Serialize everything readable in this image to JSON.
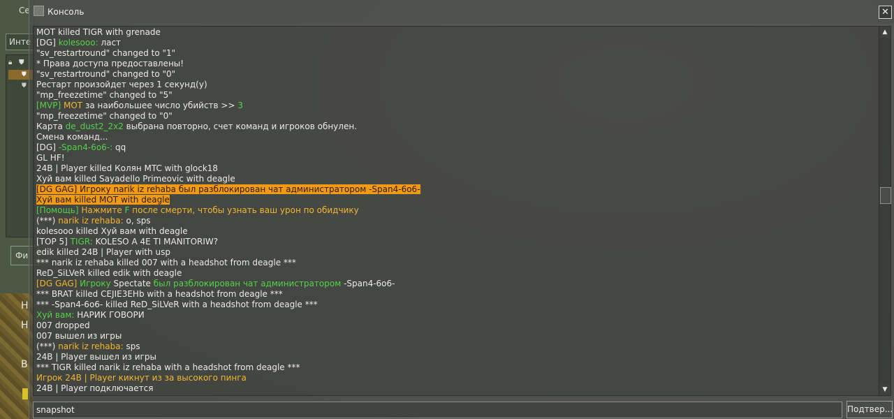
{
  "back_window": {
    "title": "Се",
    "tab_label": "Инте",
    "button_label": "Фи",
    "hud_letters": [
      "Н",
      "Н",
      "В"
    ]
  },
  "console": {
    "title": "Консоль",
    "close_label": "✕",
    "input_value": "snapshot",
    "submit_label": "Подтвер..."
  },
  "colors": {
    "green": "#52d24a",
    "orange": "#f2b630",
    "highlight": "#f29a12"
  },
  "log": [
    {
      "parts": [
        {
          "t": "MOT killed TIGR with grenade",
          "c": "white"
        }
      ]
    },
    {
      "parts": [
        {
          "t": "[DG] ",
          "c": "white"
        },
        {
          "t": "kolesooo:",
          "c": "green"
        },
        {
          "t": " ласт",
          "c": "white"
        }
      ]
    },
    {
      "parts": [
        {
          "t": "\"sv_restartround\" changed to \"1\"",
          "c": "white"
        }
      ]
    },
    {
      "parts": [
        {
          "t": "* Права доступа предоставлены!",
          "c": "white"
        }
      ]
    },
    {
      "parts": [
        {
          "t": "\"sv_restartround\" changed to \"0\"",
          "c": "white"
        }
      ]
    },
    {
      "parts": [
        {
          "t": "Рестарт произойдет через 1 секунд(у)",
          "c": "white"
        }
      ]
    },
    {
      "parts": [
        {
          "t": "\"mp_freezetime\" changed to \"5\"",
          "c": "white"
        }
      ]
    },
    {
      "parts": [
        {
          "t": "[MVP] ",
          "c": "green"
        },
        {
          "t": "MOT",
          "c": "orange"
        },
        {
          "t": " за наибольшее число убийств >> ",
          "c": "white"
        },
        {
          "t": "3",
          "c": "green"
        }
      ]
    },
    {
      "parts": [
        {
          "t": "\"mp_freezetime\" changed to \"0\"",
          "c": "white"
        }
      ]
    },
    {
      "parts": [
        {
          "t": "Карта ",
          "c": "white"
        },
        {
          "t": "de_dust2_2x2",
          "c": "green"
        },
        {
          "t": " выбрана повторно, счет команд и игроков обнулен.",
          "c": "white"
        }
      ]
    },
    {
      "parts": [
        {
          "t": "Смена команд...",
          "c": "white"
        }
      ]
    },
    {
      "parts": [
        {
          "t": "[DG] ",
          "c": "white"
        },
        {
          "t": "-Span4-6o6-:",
          "c": "green"
        },
        {
          "t": " qq",
          "c": "white"
        }
      ]
    },
    {
      "parts": [
        {
          "t": "GL HF!",
          "c": "white"
        }
      ]
    },
    {
      "parts": [
        {
          "t": "24B | Player killed Колян MTC with glock18",
          "c": "white"
        }
      ]
    },
    {
      "parts": [
        {
          "t": "Хуй вам killed Sayadello Primeovic with deagle",
          "c": "white"
        }
      ]
    },
    {
      "hl": true,
      "parts": [
        {
          "t": "[DG GAG] Игроку narik iz rehaba был разблокирован чат администратором -Span4-6o6-",
          "c": "white"
        }
      ]
    },
    {
      "hl": true,
      "parts": [
        {
          "t": "Хуй вам killed MOT with deagle",
          "c": "white"
        }
      ]
    },
    {
      "parts": [
        {
          "t": "[Помощь] ",
          "c": "green"
        },
        {
          "t": "Нажмите ",
          "c": "orange"
        },
        {
          "t": "F",
          "c": "green"
        },
        {
          "t": " после смерти, чтобы узнать ваш урон по обидчику",
          "c": "orange"
        }
      ]
    },
    {
      "parts": [
        {
          "t": "(***) ",
          "c": "white"
        },
        {
          "t": "narik iz rehaba:",
          "c": "orange"
        },
        {
          "t": " o, sps",
          "c": "white"
        }
      ]
    },
    {
      "parts": [
        {
          "t": "kolesooo killed Хуй вам with deagle",
          "c": "white"
        }
      ]
    },
    {
      "parts": [
        {
          "t": "[TOP 5] ",
          "c": "white"
        },
        {
          "t": "TIGR:",
          "c": "green"
        },
        {
          "t": " KOLESO A 4E TI MANITORIW?",
          "c": "white"
        }
      ]
    },
    {
      "parts": [
        {
          "t": "edik killed 24B | Player with usp",
          "c": "white"
        }
      ]
    },
    {
      "parts": [
        {
          "t": "*** narik iz rehaba killed 007 with a headshot from deagle ***",
          "c": "white"
        }
      ]
    },
    {
      "parts": [
        {
          "t": "ReD_SiLVeR killed edik with deagle",
          "c": "white"
        }
      ]
    },
    {
      "parts": [
        {
          "t": "[DG GAG] ",
          "c": "orange"
        },
        {
          "t": "Игроку ",
          "c": "green"
        },
        {
          "t": "Spectate",
          "c": "white"
        },
        {
          "t": " был разблокирован чат администратором ",
          "c": "green"
        },
        {
          "t": "-Span4-6o6-",
          "c": "white"
        }
      ]
    },
    {
      "parts": [
        {
          "t": "*** BRAT killed CEJIE3EHb with a headshot from deagle ***",
          "c": "white"
        }
      ]
    },
    {
      "parts": [
        {
          "t": "*** -Span4-6o6- killed ReD_SiLVeR with a headshot from deagle ***",
          "c": "white"
        }
      ]
    },
    {
      "parts": [
        {
          "t": "Хуй вам:",
          "c": "green"
        },
        {
          "t": " НАРИК ГОВОРИ",
          "c": "white"
        }
      ]
    },
    {
      "parts": [
        {
          "t": "007 dropped",
          "c": "white"
        }
      ]
    },
    {
      "parts": [
        {
          "t": "007 вышел из игры",
          "c": "white"
        }
      ]
    },
    {
      "parts": [
        {
          "t": "(***) ",
          "c": "white"
        },
        {
          "t": "narik iz rehaba:",
          "c": "orange"
        },
        {
          "t": " sps",
          "c": "white"
        }
      ]
    },
    {
      "parts": [
        {
          "t": "24B | Player вышел из игры",
          "c": "white"
        }
      ]
    },
    {
      "parts": [
        {
          "t": "*** TIGR killed narik iz rehaba with a headshot from deagle ***",
          "c": "white"
        }
      ]
    },
    {
      "parts": [
        {
          "t": "Игрок 24B | Player кикнут из за высокого пинга",
          "c": "orange"
        }
      ]
    },
    {
      "parts": [
        {
          "t": "24B | Player подключается",
          "c": "white"
        }
      ]
    }
  ]
}
